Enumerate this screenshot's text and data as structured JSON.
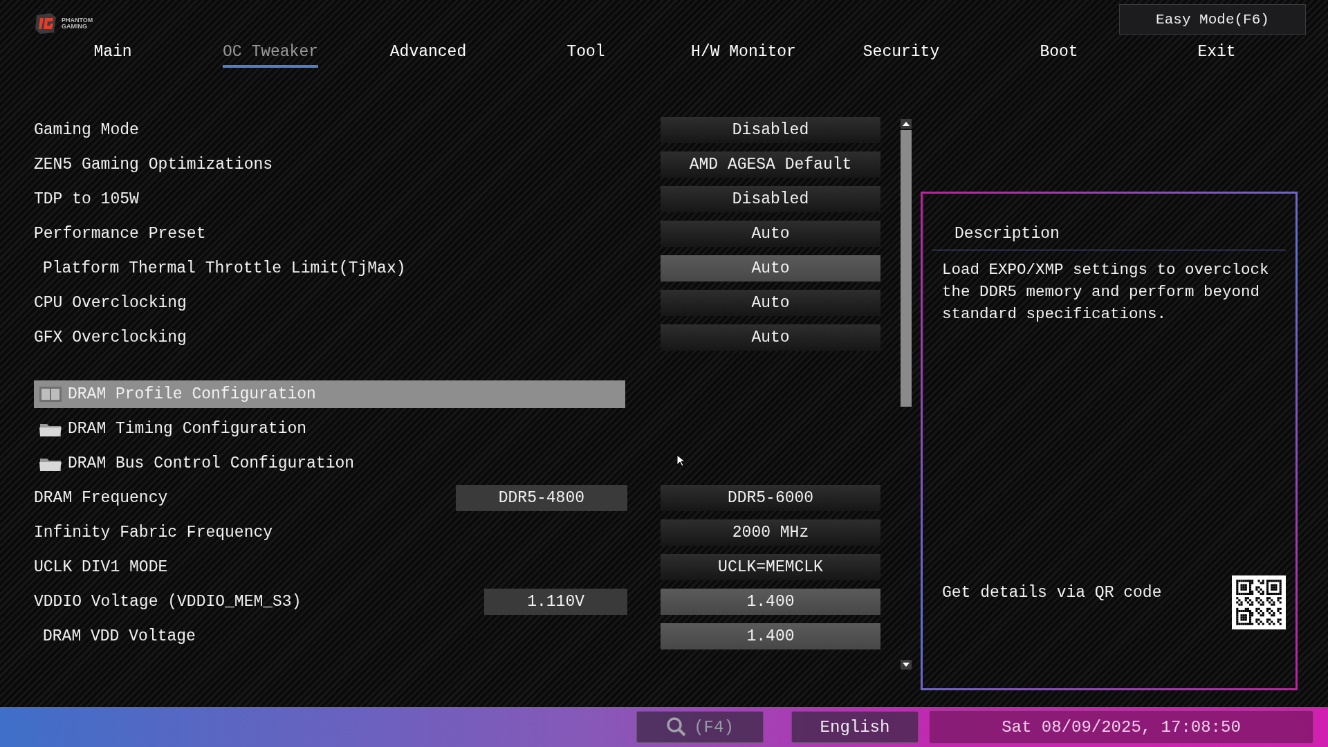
{
  "brand": {
    "line_1": "PHANTOM",
    "line_2": "GAMING"
  },
  "easy_mode_button": "Easy Mode(F6)",
  "tabs": [
    {
      "label": "Main",
      "selected": false
    },
    {
      "label": "OC Tweaker",
      "selected": true
    },
    {
      "label": "Advanced",
      "selected": false
    },
    {
      "label": "Tool",
      "selected": false
    },
    {
      "label": "H/W Monitor",
      "selected": false
    },
    {
      "label": "Security",
      "selected": false
    },
    {
      "label": "Boot",
      "selected": false
    },
    {
      "label": "Exit",
      "selected": false
    }
  ],
  "settings": [
    {
      "kind": "setting",
      "label": "Gaming Mode",
      "indented": false,
      "value": "Disabled",
      "editable": false,
      "selected": false
    },
    {
      "kind": "setting",
      "label": "ZEN5 Gaming Optimizations",
      "indented": false,
      "value": "AMD AGESA Default",
      "editable": false,
      "selected": false
    },
    {
      "kind": "setting",
      "label": "TDP to 105W",
      "indented": false,
      "value": "Disabled",
      "editable": false,
      "selected": false
    },
    {
      "kind": "setting",
      "label": "Performance Preset",
      "indented": false,
      "value": "Auto",
      "editable": false,
      "selected": false
    },
    {
      "kind": "setting",
      "label": "Platform Thermal Throttle Limit(TjMax)",
      "indented": true,
      "value": "Auto",
      "editable": true,
      "selected": false
    },
    {
      "kind": "setting",
      "label": "CPU Overclocking",
      "indented": false,
      "value": "Auto",
      "editable": false,
      "selected": false
    },
    {
      "kind": "setting",
      "label": "GFX Overclocking",
      "indented": false,
      "value": "Auto",
      "editable": false,
      "selected": false
    },
    {
      "kind": "gap"
    },
    {
      "kind": "submenu",
      "label": "DRAM Profile Configuration",
      "selected": true
    },
    {
      "kind": "submenu",
      "label": "DRAM Timing Configuration",
      "selected": false
    },
    {
      "kind": "submenu",
      "label": "DRAM Bus Control Configuration",
      "selected": false
    },
    {
      "kind": "setting",
      "label": "DRAM Frequency",
      "indented": false,
      "current": "DDR5-4800",
      "value": "DDR5-6000",
      "editable": false,
      "selected": false
    },
    {
      "kind": "setting",
      "label": "Infinity Fabric Frequency",
      "indented": false,
      "value": "2000 MHz",
      "editable": false,
      "selected": false
    },
    {
      "kind": "setting",
      "label": "UCLK DIV1 MODE",
      "indented": false,
      "value": "UCLK=MEMCLK",
      "editable": false,
      "selected": false
    },
    {
      "kind": "setting",
      "label": "VDDIO Voltage (VDDIO_MEM_S3)",
      "indented": false,
      "current": "1.110V",
      "value": "1.400",
      "editable": true,
      "selected": false
    },
    {
      "kind": "setting",
      "label": "DRAM VDD Voltage",
      "indented": true,
      "value": "1.400",
      "editable": true,
      "selected": false
    }
  ],
  "description": {
    "title": "Description",
    "text": "Load EXPO/XMP settings to overclock the DDR5 memory and perform beyond standard specifications.",
    "qr_caption": "Get details via QR code"
  },
  "status_bar": {
    "search_key": "(F4)",
    "language": "English",
    "datetime": "Sat 08/09/2025, 17:08:50"
  }
}
